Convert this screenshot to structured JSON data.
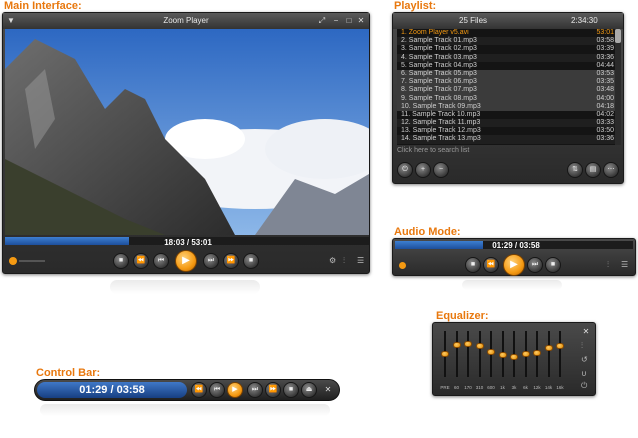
{
  "labels": {
    "main": "Main Interface:",
    "playlist": "Playlist:",
    "audio": "Audio Mode:",
    "equalizer": "Equalizer:",
    "controlbar": "Control Bar:"
  },
  "main": {
    "title": "Zoom Player",
    "time": "18:03 / 53:01",
    "progress": 0.34
  },
  "playlist": {
    "count": "25 Files",
    "total_time": "2:34:30",
    "search_placeholder": "Click here to search list",
    "items": [
      {
        "name": "1. Zoom Player v5.avi",
        "time": "53:01",
        "current": true
      },
      {
        "name": "2. Sample Track 01.mp3",
        "time": "03:58"
      },
      {
        "name": "3. Sample Track 02.mp3",
        "time": "03:39"
      },
      {
        "name": "4. Sample Track 03.mp3",
        "time": "03:36"
      },
      {
        "name": "5. Sample Track 04.mp3",
        "time": "04:44"
      },
      {
        "name": "6. Sample Track 05.mp3",
        "time": "03:53",
        "selected": true
      },
      {
        "name": "7. Sample Track 06.mp3",
        "time": "03:35",
        "selected": true
      },
      {
        "name": "8. Sample Track 07.mp3",
        "time": "03:48",
        "selected": true
      },
      {
        "name": "9. Sample Track 08.mp3",
        "time": "04:00",
        "selected": true
      },
      {
        "name": "10. Sample Track 09.mp3",
        "time": "04:18",
        "selected": true
      },
      {
        "name": "11. Sample Track 10.mp3",
        "time": "04:02"
      },
      {
        "name": "12. Sample Track 11.mp3",
        "time": "03:33"
      },
      {
        "name": "13. Sample Track 12.mp3",
        "time": "03:50"
      },
      {
        "name": "14. Sample Track 13.mp3",
        "time": "03:36"
      }
    ]
  },
  "audio": {
    "time": "01:29 / 03:58",
    "progress": 0.37
  },
  "equalizer": {
    "bands": [
      {
        "label": "PRE",
        "level": 0.0
      },
      {
        "label": "60",
        "level": 0.4
      },
      {
        "label": "170",
        "level": 0.45
      },
      {
        "label": "310",
        "level": 0.35
      },
      {
        "label": "600",
        "level": 0.1
      },
      {
        "label": "1k",
        "level": -0.05
      },
      {
        "label": "3k",
        "level": -0.15
      },
      {
        "label": "6k",
        "level": 0.0
      },
      {
        "label": "12k",
        "level": 0.05
      },
      {
        "label": "14k",
        "level": 0.25
      },
      {
        "label": "16k",
        "level": 0.35
      }
    ]
  },
  "controlbar": {
    "time": "01:29 / 03:58"
  },
  "icons": {
    "play": "▶",
    "stop": "■",
    "prev": "⏮",
    "next": "⏭",
    "rewind": "⏪",
    "forward": "⏩",
    "close": "✕",
    "minimize": "−",
    "maximize": "□",
    "eject": "⏏",
    "menu": "☰"
  }
}
